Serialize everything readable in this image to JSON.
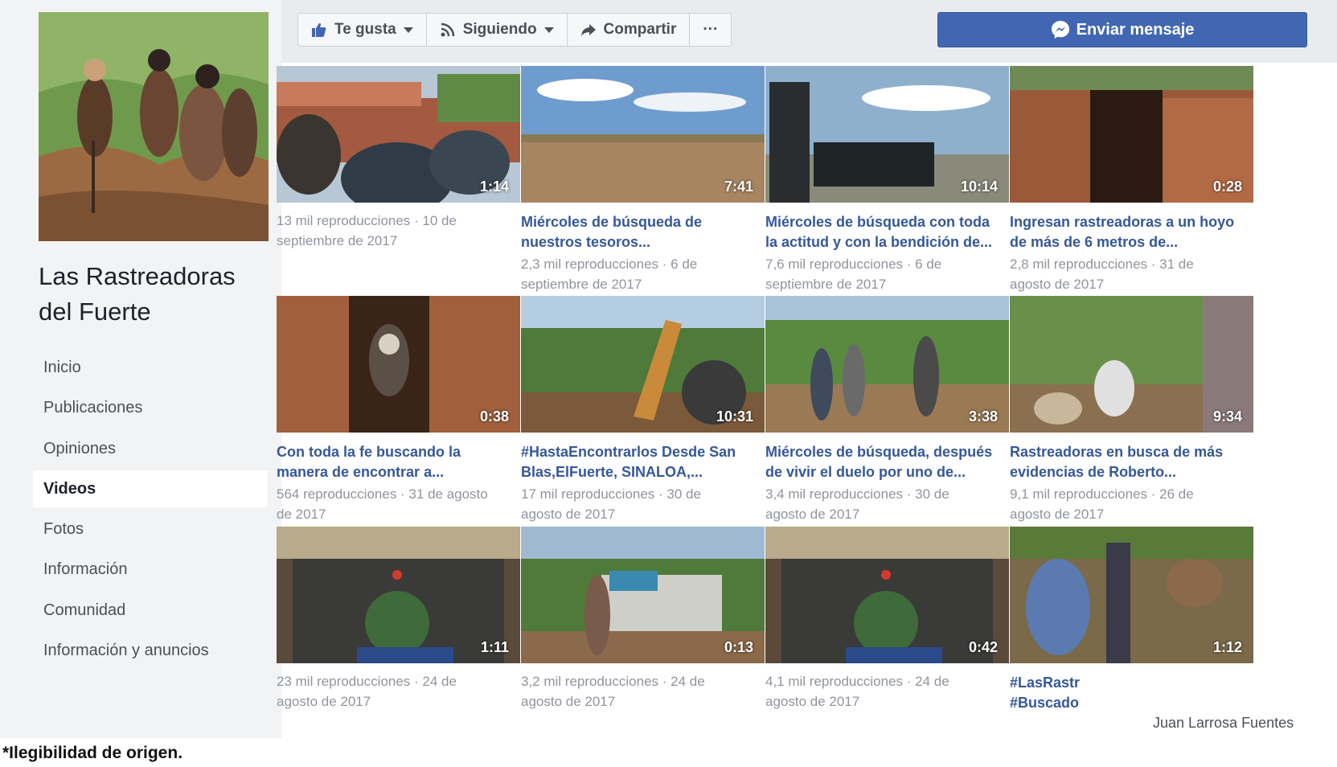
{
  "page": {
    "name": "Las Rastreadoras\ndel Fuerte",
    "profile_photo_icon": "group-digging-photo"
  },
  "nav": {
    "items": [
      {
        "label": "Inicio",
        "active": false
      },
      {
        "label": "Publicaciones",
        "active": false
      },
      {
        "label": "Opiniones",
        "active": false
      },
      {
        "label": "Videos",
        "active": true
      },
      {
        "label": "Fotos",
        "active": false
      },
      {
        "label": "Información",
        "active": false
      },
      {
        "label": "Comunidad",
        "active": false
      },
      {
        "label": "Información y anuncios",
        "active": false
      }
    ]
  },
  "actions": {
    "like_label": "Te gusta",
    "following_label": "Siguiendo",
    "share_label": "Compartir",
    "more_label": "···",
    "message_label": "Enviar mensaje"
  },
  "colors": {
    "brand_blue": "#4267b2",
    "link_blue": "#365899",
    "meta_gray": "#90949c"
  },
  "videos": [
    {
      "duration": "1:14",
      "title": "",
      "meta": "13 mil reproducciones · 10 de\nseptiembre de 2017",
      "scene": "wall-hats"
    },
    {
      "duration": "7:41",
      "title": "Miércoles de búsqueda de\nnuestros tesoros...",
      "meta": "2,3 mil reproducciones · 6 de\nseptiembre de 2017",
      "scene": "field-sky"
    },
    {
      "duration": "10:14",
      "title": "Miércoles de búsqueda con toda\nla actitud y con la bendición de...",
      "meta": "7,6 mil reproducciones · 6 de\nseptiembre de 2017",
      "scene": "police-truck"
    },
    {
      "duration": "0:28",
      "title": "Ingresan rastreadoras a un hoyo\nde más de 6 metros de...",
      "meta": "2,8 mil reproducciones · 31 de\nagosto de 2017",
      "scene": "dirt-hole"
    },
    {
      "duration": "0:38",
      "title": "Con toda la fe buscando la\nmanera de encontrar a...",
      "meta": "564 reproducciones · 31 de agosto\nde 2017",
      "scene": "dirt-hole-person"
    },
    {
      "duration": "10:31",
      "title": "#HastaEncontrarlos Desde San\nBlas,ElFuerte, SINALOA,...",
      "meta": "17 mil reproducciones · 30 de\nagosto de 2017",
      "scene": "backhoe"
    },
    {
      "duration": "3:38",
      "title": "Miércoles de búsqueda, después\nde vivir el duelo por uno de...",
      "meta": "3,4 mil reproducciones · 30 de\nagosto de 2017",
      "scene": "brush-group"
    },
    {
      "duration": "9:34",
      "title": "Rastreadoras en busca de más\nevidencias de Roberto...",
      "meta": "9,1 mil reproducciones · 26 de\nagosto de 2017",
      "scene": "brush-digging"
    },
    {
      "duration": "1:11",
      "title": "",
      "meta": "23 mil reproducciones · 24 de\nagosto de 2017",
      "scene": "altar"
    },
    {
      "duration": "0:13",
      "title": "",
      "meta": "3,2 mil reproducciones · 24 de\nagosto de 2017",
      "scene": "pickup"
    },
    {
      "duration": "0:42",
      "title": "",
      "meta": "4,1 mil reproducciones · 24 de\nagosto de 2017",
      "scene": "altar"
    },
    {
      "duration": "1:12",
      "title": "#LasRastr\n#Buscado",
      "meta": "",
      "scene": "digging-closeup"
    }
  ],
  "attribution": "Juan Larrosa Fuentes",
  "caption": "*Ilegibilidad de origen."
}
